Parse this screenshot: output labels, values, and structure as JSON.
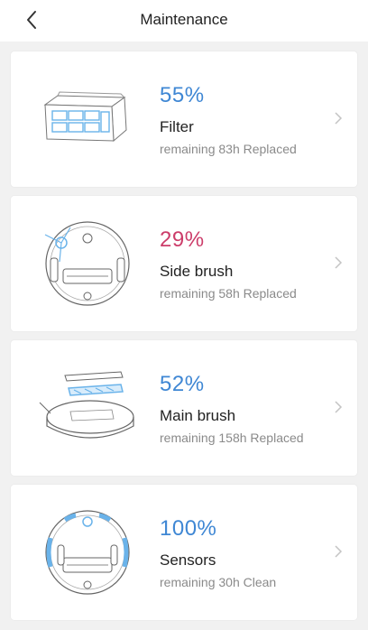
{
  "header": {
    "title": "Maintenance",
    "back_icon": "chevron-left-icon"
  },
  "colors": {
    "blue": "#3f87d4",
    "pink": "#cc3d6a",
    "accent_light": "#6ab3ea"
  },
  "items": [
    {
      "percent": "55%",
      "name": "Filter",
      "status": "remaining 83h Replaced",
      "color": "#3f87d4",
      "icon": "filter-icon"
    },
    {
      "percent": "29%",
      "name": "Side brush",
      "status": "remaining 58h Replaced",
      "color": "#cc3d6a",
      "icon": "side-brush-icon"
    },
    {
      "percent": "52%",
      "name": "Main brush",
      "status": "remaining 158h Replaced",
      "color": "#3f87d4",
      "icon": "main-brush-icon"
    },
    {
      "percent": "100%",
      "name": "Sensors",
      "status": "remaining 30h Clean",
      "color": "#3f87d4",
      "icon": "sensors-icon"
    }
  ]
}
